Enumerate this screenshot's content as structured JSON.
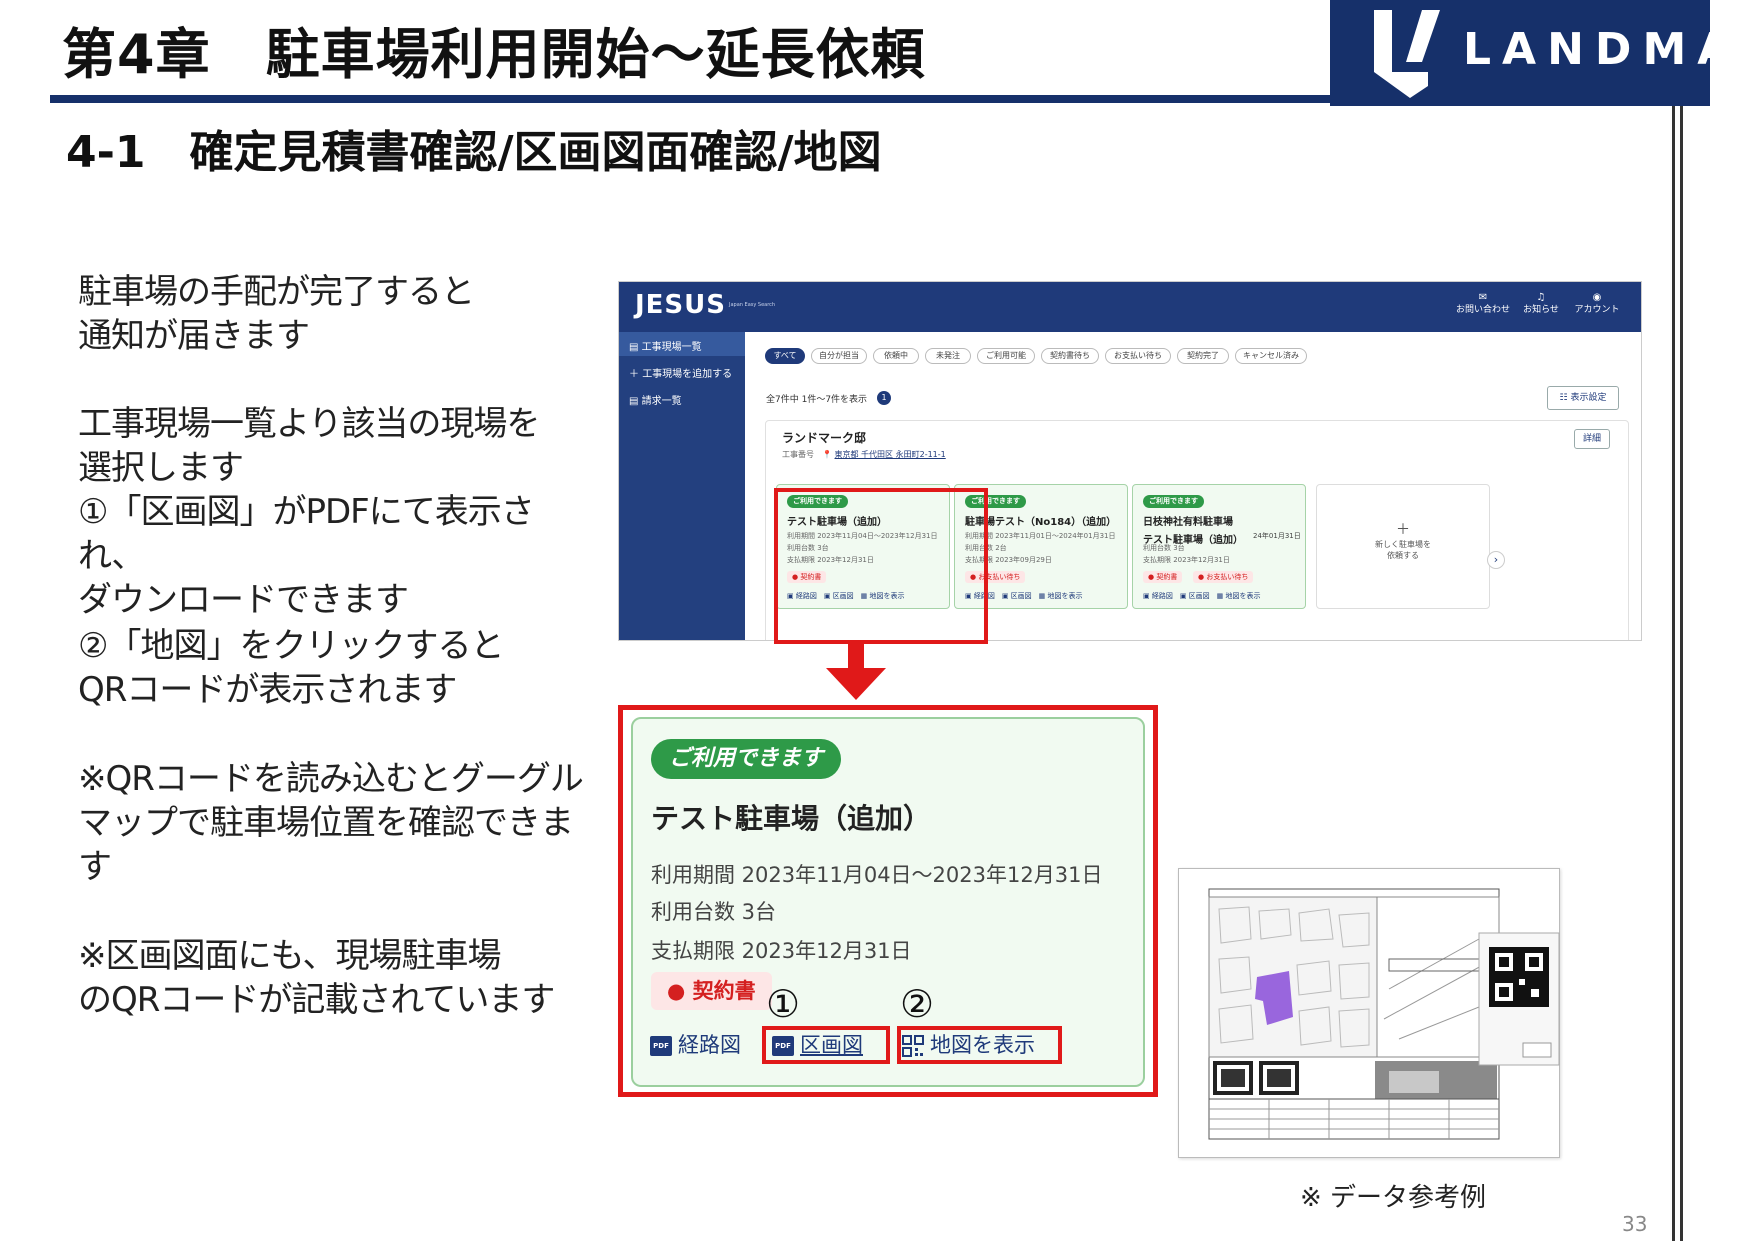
{
  "slide": {
    "chapter_title": "第4章　駐車場利用開始〜延長依頼",
    "section_title": "4-1　確定見積書確認/区画図面確認/地図",
    "logo_text": "LANDMARK",
    "page_number": "33",
    "doc_caption": "※ データ参考例"
  },
  "body": {
    "p1_line1": "駐車場の手配が完了すると",
    "p1_line2": "通知が届きます",
    "p2_line1": "工事現場一覧より該当の現場を",
    "p2_line2": "選択します",
    "p2_line3": "①「区画図」がPDFにて表示され、",
    "p2_line4": "ダウンロードできます",
    "p3_line1": "②「地図」をクリックすると",
    "p3_line2": "QRコードが表示されます",
    "p4_line1": "※QRコードを読み込むとグーグル",
    "p4_line2": "マップで駐車場位置を確認できま",
    "p4_line3": "す",
    "p5_line1": "※区画図面にも、現場駐車場",
    "p5_line2": "のQRコードが記載されています"
  },
  "app": {
    "brand": "JESUS",
    "brand_sub": "Japan Easy Search",
    "nav": [
      {
        "icon": "✉",
        "label": "お問い合わせ"
      },
      {
        "icon": "♫",
        "label": "お知らせ"
      },
      {
        "icon": "◉",
        "label": "アカウント"
      }
    ],
    "sidebar": {
      "item1": "工事現場一覧",
      "item2": "工事現場を追加する",
      "item3": "請求一覧"
    },
    "chips": [
      "すべて",
      "自分が担当",
      "依頼中",
      "未発注",
      "ご利用可能",
      "契約書待ち",
      "お支払い待ち",
      "契約完了",
      "キャンセル済み"
    ],
    "result_count": "全7件中 1件〜7件を表示",
    "result_badge": "1",
    "col_settings": "☷ 表示設定",
    "site_name": "ランドマーク邸",
    "site_meta_label": "工事番号",
    "site_addr": "東京都 千代田区 永田町2-11-1",
    "detail_btn": "詳細",
    "cards": [
      {
        "badge": "ご利用できます",
        "name": "テスト駐車場（追加）",
        "l1": "利用期間 2023年11月04日〜2023年12月31日",
        "l2": "利用台数 3台",
        "l3": "支払期限 2023年12月31日",
        "tag1": "● 契約書",
        "tag2": "",
        "links": "▣ 経路図　▣ 区画図　▦ 地図を表示"
      },
      {
        "badge": "ご利用できます",
        "name": "駐車場テスト（No184）（追加）",
        "l1": "利用期間 2023年11月01日〜2024年01月31日",
        "l2": "利用台数 2台",
        "l3": "支払期限 2023年09月29日",
        "tag1": "● お支払い待ち",
        "tag2": "",
        "links": "▣ 経路図　▣ 区画図　▦ 地図を表示"
      },
      {
        "badge": "ご利用できます",
        "name": "日枝神社有料駐車場",
        "name2": "テスト駐車場（追加）",
        "date": "24年01月31日",
        "l1": "利用台数 3台",
        "l2": "支払期限 2023年12月31日",
        "l3": "",
        "tag1": "● 契約書",
        "tag2": "● お支払い待ち",
        "links": "▣ 経路図　▣ 区画図　▦ 地図を表示"
      }
    ],
    "new_card_line1": "新しく駐車場を",
    "new_card_line2": "依頼する",
    "next_icon": "›"
  },
  "zoom_card": {
    "badge": "ご利用できます",
    "name": "テスト駐車場（追加）",
    "period": "利用期間 2023年11月04日〜2023年12月31日",
    "count": "利用台数 3台",
    "deadline": "支払期限 2023年12月31日",
    "tag": "● 契約書",
    "link_route": "経路図",
    "link_kukaku": "区画図",
    "link_map": "地図を表示",
    "pdf_icon_text": "PDF",
    "marker1": "①",
    "marker2": "②"
  },
  "colors": {
    "navy": "#16306a",
    "accent_red": "#e01919",
    "status_green": "#2e9a48"
  }
}
